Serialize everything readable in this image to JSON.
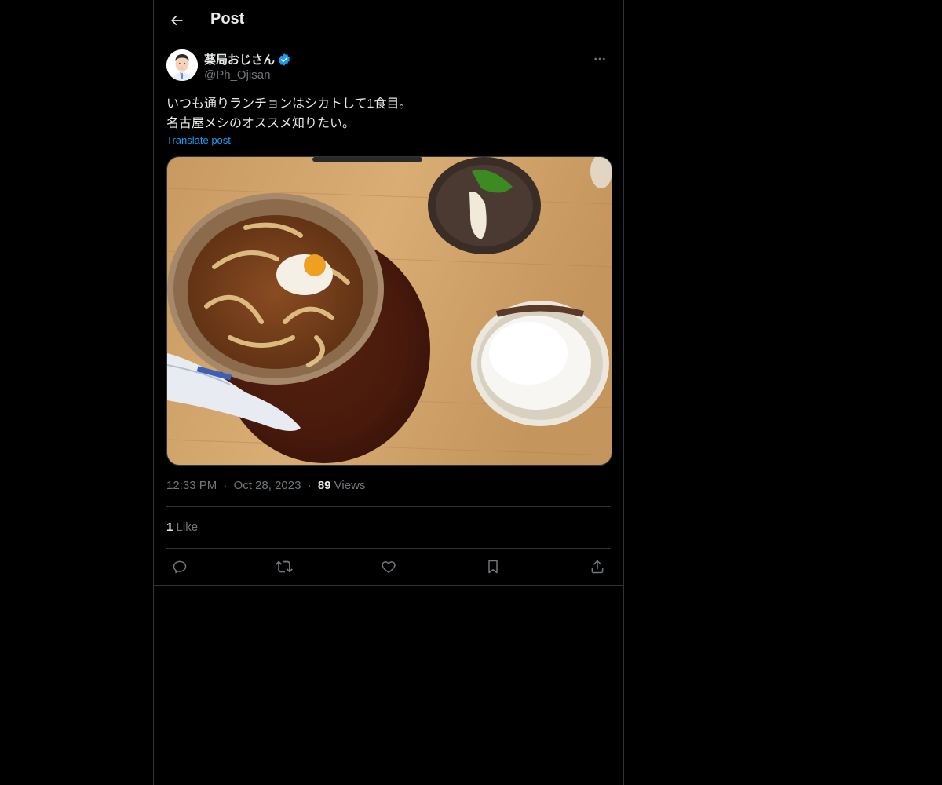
{
  "header": {
    "title": "Post"
  },
  "author": {
    "display_name": "薬局おじさん",
    "handle": "@Ph_Ojisan",
    "verified": true
  },
  "post": {
    "text_line1": "いつも通りランチョンはシカトして1食目。",
    "text_line2": "名古屋メシのオススメ知りたい。",
    "translate_label": "Translate post",
    "media_description": "miso-nikomi-udon-set-photo",
    "time": "12:33 PM",
    "separator": "·",
    "date": "Oct 28, 2023",
    "views_count": "89",
    "views_label": "Views",
    "likes_count": "1",
    "likes_label": "Like"
  },
  "icons": {
    "back": "back-arrow-icon",
    "more": "more-icon",
    "verified": "verified-badge-icon",
    "reply": "reply-icon",
    "repost": "repost-icon",
    "like": "like-icon",
    "bookmark": "bookmark-icon",
    "share": "share-icon"
  },
  "colors": {
    "background": "#000000",
    "text": "#e7e9ea",
    "muted": "#71767b",
    "accent": "#1d9bf0",
    "border": "#2f3336"
  }
}
